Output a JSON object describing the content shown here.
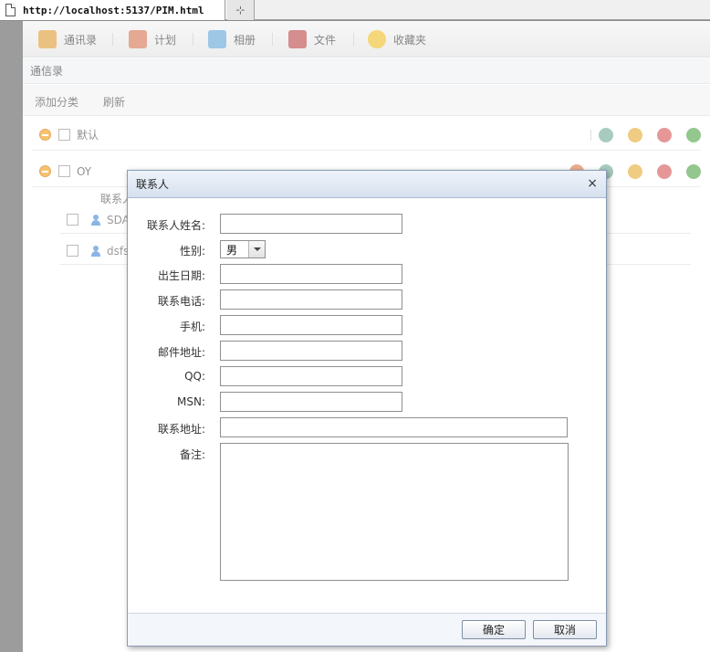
{
  "browser": {
    "tab_title": "http://localhost:5137/PIM.html",
    "new_tab_symbol": "⊹"
  },
  "toolbar": {
    "items": [
      {
        "label": "通讯录",
        "icon": "address-book-icon",
        "color": "#e0a040"
      },
      {
        "label": "计划",
        "icon": "calendar-icon",
        "color": "#d87a5a"
      },
      {
        "label": "相册",
        "icon": "photo-album-icon",
        "color": "#6aa8d8"
      },
      {
        "label": "文件",
        "icon": "file-cabinet-icon",
        "color": "#c05050"
      },
      {
        "label": "收藏夹",
        "icon": "star-icon",
        "color": "#f0c030"
      }
    ]
  },
  "subbar": {
    "title": "通信录"
  },
  "actions": {
    "add_category": "添加分类",
    "refresh": "刷新"
  },
  "groups": [
    {
      "label": "默认"
    },
    {
      "label": "OY",
      "sub_header": "联系人"
    }
  ],
  "contacts": [
    {
      "name": "SDA"
    },
    {
      "name": "dsfs"
    }
  ],
  "dialog": {
    "title": "联系人",
    "close_symbol": "×",
    "fields": {
      "name_label": "联系人姓名:",
      "name_value": "",
      "gender_label": "性别:",
      "gender_value": "男",
      "birthday_label": "出生日期:",
      "birthday_value": "",
      "phone_label": "联系电话:",
      "phone_value": "",
      "mobile_label": "手机:",
      "mobile_value": "",
      "email_label": "邮件地址:",
      "email_value": "",
      "qq_label": "QQ:",
      "qq_value": "",
      "msn_label": "MSN:",
      "msn_value": "",
      "address_label": "联系地址:",
      "address_value": "",
      "notes_label": "备注:",
      "notes_value": ""
    },
    "ok_label": "确定",
    "cancel_label": "取消"
  }
}
